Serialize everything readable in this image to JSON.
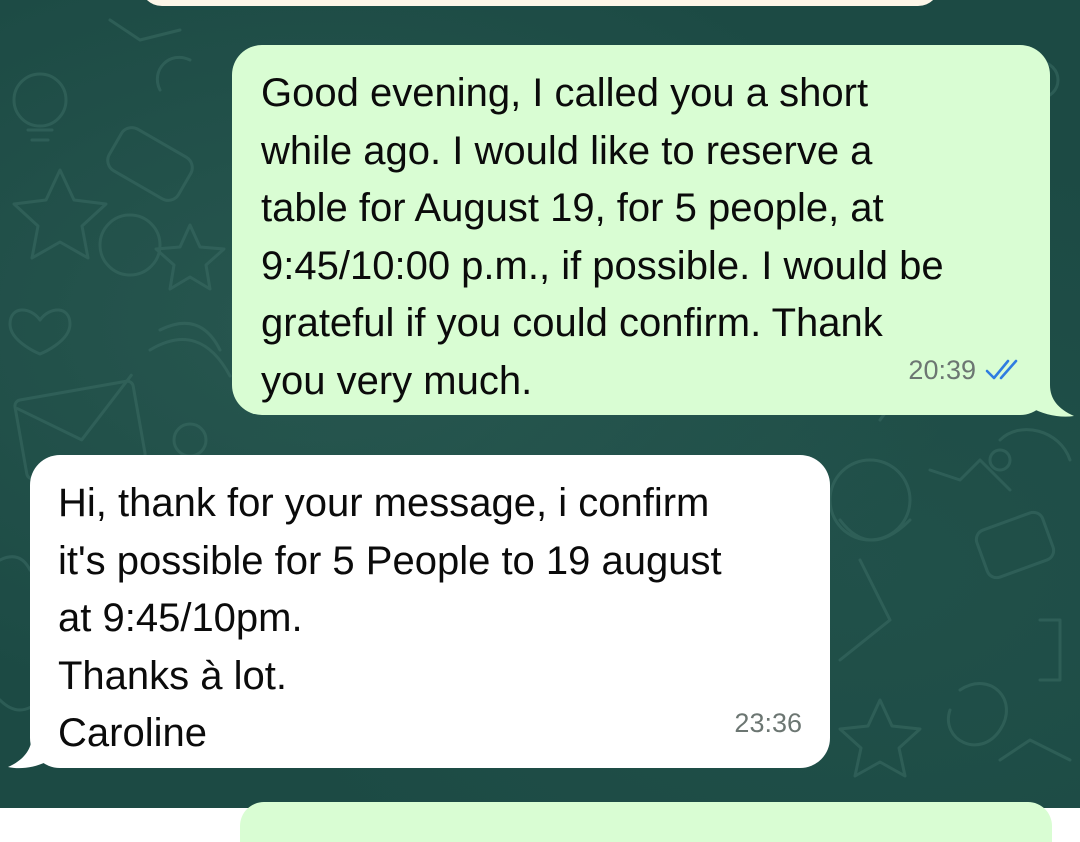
{
  "conversation": {
    "outgoing": {
      "lines": [
        "Good evening, I called you a short",
        "while ago. I would like to reserve a",
        "table for August 19, for 5 people, at",
        "9:45/10:00 p.m., if possible. I would be",
        "grateful if you could confirm. Thank",
        "you very much."
      ],
      "time": "20:39",
      "status_icon": "double-check-read-icon",
      "bubble_color": "#d9fdd3",
      "tick_color": "#2f7de1"
    },
    "incoming": {
      "lines": [
        "Hi, thank for your message, i confirm",
        "it's possible for 5 People to 19 august",
        "at 9:45/10pm.",
        "Thanks à lot.",
        "Caroline"
      ],
      "time": "23:36",
      "bubble_color": "#ffffff"
    },
    "background_color": "#1c4a44"
  }
}
